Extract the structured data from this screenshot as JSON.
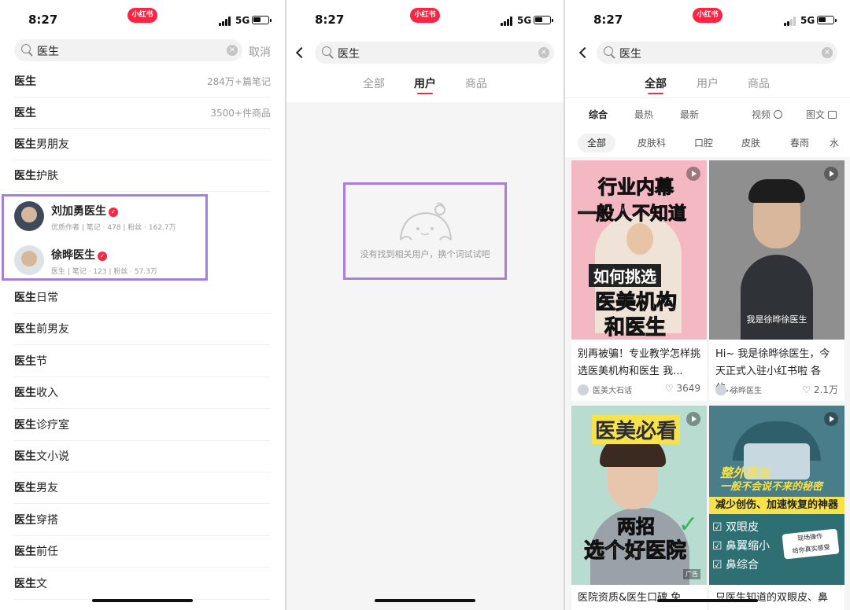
{
  "status": {
    "time": "8:27",
    "app_badge": "小红书",
    "network": "5G"
  },
  "screen1": {
    "search_query": "医生",
    "cancel_label": "取消",
    "suggestions_top": [
      {
        "kw": "医生",
        "rest": "",
        "count": "284万+篇笔记"
      },
      {
        "kw": "医生",
        "rest": "",
        "count": "3500+件商品"
      },
      {
        "kw": "医生",
        "rest": "男朋友",
        "count": ""
      },
      {
        "kw": "医生",
        "rest": "护肤",
        "count": ""
      }
    ],
    "users": [
      {
        "name": "刘加勇医生",
        "meta": "优质作者 | 笔记 · 478 | 粉丝 · 162.7万"
      },
      {
        "name": "徐晔医生",
        "meta": "医生 | 笔记 · 123 | 粉丝 · 57.3万"
      }
    ],
    "suggestions_bottom": [
      {
        "kw": "医生",
        "rest": "日常"
      },
      {
        "kw": "医生",
        "rest": "前男友"
      },
      {
        "kw": "医生",
        "rest": "节"
      },
      {
        "kw": "医生",
        "rest": "收入"
      },
      {
        "kw": "医生",
        "rest": "诊疗室"
      },
      {
        "kw": "医生",
        "rest": "文小说"
      },
      {
        "kw": "医生",
        "rest": "男友"
      },
      {
        "kw": "医生",
        "rest": "穿搭"
      },
      {
        "kw": "医生",
        "rest": "前任"
      },
      {
        "kw": "医生",
        "rest": "文"
      }
    ]
  },
  "screen2": {
    "search_query": "医生",
    "tabs": [
      "全部",
      "用户",
      "商品"
    ],
    "active_tab": "用户",
    "empty_text": "没有找到相关用户，换个词试试吧"
  },
  "screen3": {
    "search_query": "医生",
    "tabs": [
      "全部",
      "用户",
      "商品"
    ],
    "active_tab": "全部",
    "sort": {
      "comprehensive": "综合",
      "hottest": "最热",
      "newest": "最新",
      "video": "视频",
      "image_text": "图文"
    },
    "chips": [
      "全部",
      "皮肤科",
      "口腔",
      "皮肤",
      "春雨",
      "水"
    ],
    "cards": [
      {
        "overlay": [
          "行业内幕",
          "一般人不知道",
          "如何挑选",
          "医美机构",
          "和医生"
        ],
        "title": "别再被骗！专业教学怎样挑选医美机构和医生 我...",
        "user": "医美大石话",
        "likes": "3649"
      },
      {
        "overlay": [
          "我是徐晔徐医生"
        ],
        "title": "Hi~ 我是徐晔徐医生，今天正式入驻小红书啦 各位...",
        "user": "徐晔医生",
        "likes": "2.1万"
      },
      {
        "overlay": [
          "医美必看",
          "两招",
          "选个好医院",
          "广告"
        ],
        "title": "医院资质&医生口碑 免",
        "user": "",
        "likes": ""
      },
      {
        "overlay": [
          "整外医生",
          "一般不会说不来的秘密",
          "减少创伤、加速恢复的神器",
          "双眼皮",
          "鼻翼缩小",
          "鼻综合",
          "现场操作",
          "给你真实感受"
        ],
        "title": "只医生知道的双眼皮、鼻",
        "user": "",
        "likes": ""
      }
    ]
  }
}
